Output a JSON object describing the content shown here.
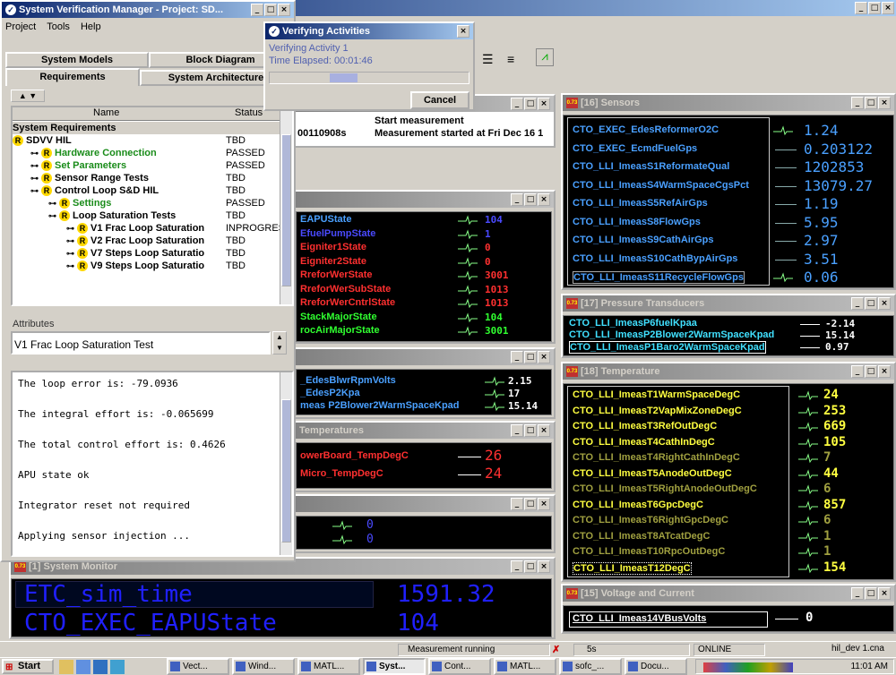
{
  "app": {
    "title": "System Verification Manager - Project: SD...",
    "menu": [
      "Project",
      "Tools",
      "Help"
    ],
    "tabs_top": [
      "System Models",
      "Block Diagram"
    ],
    "tabs_bottom": [
      "Requirements",
      "System Architecture"
    ],
    "col_name": "Name",
    "col_status": "Status",
    "tree": [
      {
        "name": "System Requirements",
        "status": "",
        "indent": 0,
        "color": "#000",
        "header": true
      },
      {
        "name": "SDVV HIL",
        "status": "TBD",
        "indent": 0,
        "color": "#000"
      },
      {
        "name": "Hardware Connection",
        "status": "PASSED",
        "indent": 1,
        "color": "#1a8c1a"
      },
      {
        "name": "Set Parameters",
        "status": "PASSED",
        "indent": 1,
        "color": "#1a8c1a"
      },
      {
        "name": "Sensor Range Tests",
        "status": "TBD",
        "indent": 1,
        "color": "#000"
      },
      {
        "name": "Control Loop S&D HIL",
        "status": "TBD",
        "indent": 1,
        "color": "#000"
      },
      {
        "name": "Settings",
        "status": "PASSED",
        "indent": 2,
        "color": "#1a8c1a"
      },
      {
        "name": "Loop Saturation Tests",
        "status": "TBD",
        "indent": 2,
        "color": "#000"
      },
      {
        "name": "V1 Frac Loop Saturation",
        "status": "INPROGRES",
        "indent": 3,
        "color": "#000"
      },
      {
        "name": "V2 Frac Loop Saturation",
        "status": "TBD",
        "indent": 3,
        "color": "#000"
      },
      {
        "name": "V7 Steps Loop Saturatio",
        "status": "TBD",
        "indent": 3,
        "color": "#000"
      },
      {
        "name": "V9 Steps Loop Saturatio",
        "status": "TBD",
        "indent": 3,
        "color": "#000"
      }
    ],
    "attributes_label": "Attributes",
    "attributes_value": "V1 Frac Loop Saturation Test",
    "console": [
      "The loop error is: -79.0936",
      "The integral effort is: -0.065699",
      "The total control effort is: 0.4626",
      "APU state ok",
      "Integrator reset not required",
      "Applying sensor injection ..."
    ]
  },
  "dialog": {
    "title": "Verifying Activities",
    "activity": "Verifying Activity 1",
    "elapsed": "Time Elapsed: 00:01:46",
    "cancel": "Cancel",
    "progress": 0.35
  },
  "log": {
    "line1": "Start measurement",
    "ts": "00110908s",
    "line2": "Measurement started at  Fri Dec 16 1"
  },
  "state_panel": {
    "rows": [
      {
        "label": "EAPUState",
        "value": "104",
        "lc": "#4aa0ff",
        "vc": "#4a4aff"
      },
      {
        "label": "EfuelPumpState",
        "value": "1",
        "lc": "#4a4aff",
        "vc": "#4a4aff"
      },
      {
        "label": "Eigniter1State",
        "value": "0",
        "lc": "#ff3030",
        "vc": "#ff3030"
      },
      {
        "label": "Eigniter2State",
        "value": "0",
        "lc": "#ff3030",
        "vc": "#ff3030"
      },
      {
        "label": "RreforWerState",
        "value": "3001",
        "lc": "#ff3030",
        "vc": "#ff3030"
      },
      {
        "label": "RreforWerSubState",
        "value": "1013",
        "lc": "#ff3030",
        "vc": "#ff3030"
      },
      {
        "label": "RreforWerCntrlState",
        "value": "1013",
        "lc": "#ff3030",
        "vc": "#ff3030"
      },
      {
        "label": "StackMajorState",
        "value": "104",
        "lc": "#30ff30",
        "vc": "#30ff30"
      },
      {
        "label": "rocAirMajorState",
        "value": "3001",
        "lc": "#30ff30",
        "vc": "#30ff30"
      }
    ]
  },
  "blower_panel": {
    "rows": [
      {
        "label": "_EdesBlwrRpmVolts",
        "value": "2.15"
      },
      {
        "label": "_EdesP2Kpa",
        "value": "17"
      },
      {
        "label": "meas P2Blower2WarmSpaceKpad",
        "value": "15.14"
      }
    ]
  },
  "temp_small": {
    "title": "Temperatures",
    "rows": [
      {
        "label": "owerBoard_TempDegC",
        "value": "26"
      },
      {
        "label": "Micro_TempDegC",
        "value": "24"
      }
    ]
  },
  "mini_panel": {
    "rows": [
      "0",
      "0"
    ]
  },
  "monitor": {
    "title": "[1] System Monitor",
    "l1": "ETC_sim_time",
    "v1": "1591.32",
    "l2": "CTO_EXEC_EAPUState",
    "v2": "104"
  },
  "sensors": {
    "title": "[16] Sensors",
    "rows": [
      {
        "label": "CTO_EXEC_EdesReformerO2C",
        "value": "1.24"
      },
      {
        "label": "CTO_EXEC_EcmdFuelGps",
        "value": "0.203122"
      },
      {
        "label": "CTO_LLI_ImeasS1ReformateQual",
        "value": "1202853"
      },
      {
        "label": "CTO_LLI_ImeasS4WarmSpaceCgsPct",
        "value": "13079.27"
      },
      {
        "label": "CTO_LLI_ImeasS5RefAirGps",
        "value": "1.19"
      },
      {
        "label": "CTO_LLI_ImeasS8FlowGps",
        "value": "5.95"
      },
      {
        "label": "CTO_LLI_ImeasS9CathAirGps",
        "value": "2.97"
      },
      {
        "label": "CTO_LLI_ImeasS10CathBypAirGps",
        "value": "3.51"
      },
      {
        "label": "CTO_LLI_ImeasS11RecycleFlowGps",
        "value": "0.06"
      }
    ]
  },
  "pressure": {
    "title": "[17] Pressure Transducers",
    "rows": [
      {
        "label": "CTO_LLI_ImeasP6fuelKpaa",
        "value": "-2.14"
      },
      {
        "label": "CTO_LLI_ImeasP2Blower2WarmSpaceKpad",
        "value": "15.14"
      },
      {
        "label": "CTO_LLI_ImeasP1Baro2WarmSpaceKpad",
        "value": "0.97"
      }
    ]
  },
  "temperature": {
    "title": "[18] Temperature",
    "rows": [
      {
        "label": "CTO_LLI_ImeasT1WarmSpaceDegC",
        "value": "24",
        "c": "#ffff40"
      },
      {
        "label": "CTO_LLI_ImeasT2VapMixZoneDegC",
        "value": "253",
        "c": "#ffff40"
      },
      {
        "label": "CTO_LLI_ImeasT3RefOutDegC",
        "value": "669",
        "c": "#ffff40"
      },
      {
        "label": "CTO_LLI_ImeasT4CathInDegC",
        "value": "105",
        "c": "#ffff40"
      },
      {
        "label": "CTO_LLI_ImeasT4RightCathInDegC",
        "value": "7",
        "c": "#a0a040"
      },
      {
        "label": "CTO_LLI_ImeasT5AnodeOutDegC",
        "value": "44",
        "c": "#ffff40"
      },
      {
        "label": "CTO_LLI_ImeasT5RightAnodeOutDegC",
        "value": "6",
        "c": "#a0a040"
      },
      {
        "label": "CTO_LLI_ImeasT6GpcDegC",
        "value": "857",
        "c": "#ffff40"
      },
      {
        "label": "CTO_LLI_ImeasT6RightGpcDegC",
        "value": "6",
        "c": "#a0a040"
      },
      {
        "label": "CTO_LLI_ImeasT8ATcatDegC",
        "value": "1",
        "c": "#a0a040"
      },
      {
        "label": "CTO_LLI_ImeasT10RpcOutDegC",
        "value": "1",
        "c": "#a0a040"
      },
      {
        "label": "CTO_LLI_ImeasT12DegC",
        "value": "154",
        "c": "#ffff40"
      }
    ]
  },
  "voltage": {
    "title": "[15] Voltage and Current",
    "label": "CTO_LLI_Imeas14VBusVolts",
    "value": "0"
  },
  "status": {
    "msg": "Measurement running",
    "time": "5s",
    "conn": "ONLINE",
    "file": "hil_dev 1.cna"
  },
  "taskbar": {
    "start": "Start",
    "items": [
      "Vect...",
      "Wind...",
      "MATL...",
      "Syst...",
      "Cont...",
      "MATL...",
      "sofc_...",
      "Docu..."
    ],
    "clock": "11:01 AM"
  }
}
